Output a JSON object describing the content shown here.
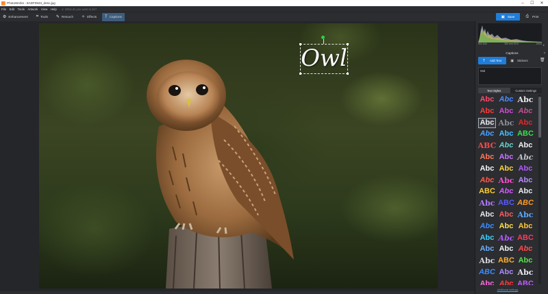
{
  "window": {
    "title": "PhotoWorks - 8ADF0523_desc.jpg",
    "controls": [
      "–",
      "☐",
      "✕"
    ]
  },
  "menu": {
    "items": [
      "File",
      "Edit",
      "Tools",
      "Artwork",
      "View",
      "Help"
    ],
    "search_placeholder": "What do you want to do?"
  },
  "toolbar": {
    "tools": [
      {
        "id": "enhancement",
        "label": "Enhancement",
        "icon": "sliders-icon",
        "glyph": "⚙"
      },
      {
        "id": "tools",
        "label": "Tools",
        "icon": "crop-icon",
        "glyph": "⌗"
      },
      {
        "id": "retouch",
        "label": "Retouch",
        "icon": "brush-icon",
        "glyph": "✎"
      },
      {
        "id": "effects",
        "label": "Effects",
        "icon": "magic-wand-icon",
        "glyph": "✧"
      },
      {
        "id": "captions",
        "label": "Captions",
        "icon": "text-icon",
        "glyph": "T",
        "active": true
      }
    ],
    "save_label": "Save",
    "print_label": "Print",
    "accent": "#1f7ed9"
  },
  "canvas": {
    "caption_text": "Owl"
  },
  "panel": {
    "histogram": {
      "left_label": "ISO 640",
      "mid_label": "300 mm f/3.5",
      "right_label": "1/500",
      "expand": "▸"
    },
    "section_title": "Captions",
    "help": "?",
    "add_text_label": "Add Text",
    "stickers_label": "Stickers",
    "text_value": "Owl",
    "tabs": [
      "Text Styles",
      "Custom Settings"
    ],
    "styles": [
      {
        "t": "Abc",
        "c": "#ff4a6a"
      },
      {
        "t": "Abc",
        "c": "#4a8cff"
      },
      {
        "t": "Abc",
        "c": "#e8eaef"
      },
      {
        "t": "Abc",
        "c": "#ff3b3b"
      },
      {
        "t": "Abc",
        "c": "#d04ad8"
      },
      {
        "t": "Abc",
        "c": "#c05090"
      },
      {
        "t": "Abc",
        "c": "#e8eaef",
        "sel": true
      },
      {
        "t": "Abc",
        "c": "#8a8f96"
      },
      {
        "t": "Abc",
        "c": "#e02a2a"
      },
      {
        "t": "Abc",
        "c": "#4aa0ff"
      },
      {
        "t": "Abc",
        "c": "#46c0ff"
      },
      {
        "t": "ABC",
        "c": "#39e04a"
      },
      {
        "t": "ABC",
        "c": "#ff4a4a"
      },
      {
        "t": "Abc",
        "c": "#6ad0c8"
      },
      {
        "t": "Abc",
        "c": "#f0f2f5"
      },
      {
        "t": "Abc",
        "c": "#ff7a5a"
      },
      {
        "t": "Abc",
        "c": "#c874ff"
      },
      {
        "t": "Abc",
        "c": "#bfc3c8"
      },
      {
        "t": "Abc",
        "c": "#f4f6f8"
      },
      {
        "t": "Abc",
        "c": "#ffd43b"
      },
      {
        "t": "Abc",
        "c": "#b05aff"
      },
      {
        "t": "Abc",
        "c": "#ff5a4a"
      },
      {
        "t": "Abc",
        "c": "#ff4ad0"
      },
      {
        "t": "Abc",
        "c": "#b58cff"
      },
      {
        "t": "ABC",
        "c": "#ffcc33"
      },
      {
        "t": "Abc",
        "c": "#d45aff"
      },
      {
        "t": "Abc",
        "c": "#e8eaef"
      },
      {
        "t": "Abc",
        "c": "#b07aff"
      },
      {
        "t": "ABC",
        "c": "#5a5aff"
      },
      {
        "t": "ABC",
        "c": "#ff9a2a"
      },
      {
        "t": "Abc",
        "c": "#e8eaef"
      },
      {
        "t": "Abc",
        "c": "#ff5a5a"
      },
      {
        "t": "Abc",
        "c": "#5aa8ff"
      },
      {
        "t": "Abc",
        "c": "#3a8cff"
      },
      {
        "t": "Abc",
        "c": "#ffe04a"
      },
      {
        "t": "Abc",
        "c": "#ffc83a"
      },
      {
        "t": "Abc",
        "c": "#3ad0ff"
      },
      {
        "t": "Abc",
        "c": "#b45aff"
      },
      {
        "t": "ABC",
        "c": "#ff3a5a"
      },
      {
        "t": "Abc",
        "c": "#6ab0ff"
      },
      {
        "t": "Abc",
        "c": "#f0f2f5"
      },
      {
        "t": "Abc",
        "c": "#ff4a4a"
      },
      {
        "t": "Abc",
        "c": "#d8dadd"
      },
      {
        "t": "ABC",
        "c": "#ffb030"
      },
      {
        "t": "Abc",
        "c": "#5ae04a"
      },
      {
        "t": "ABC",
        "c": "#3a8cff"
      },
      {
        "t": "Abc",
        "c": "#b08aff"
      },
      {
        "t": "Abc",
        "c": "#e8eaef"
      },
      {
        "t": "Abc",
        "c": "#ff6ad8"
      },
      {
        "t": "Abc",
        "c": "#ff3a3a"
      },
      {
        "t": "ABC",
        "c": "#c05aff"
      }
    ],
    "more_link": "Additional settings"
  }
}
